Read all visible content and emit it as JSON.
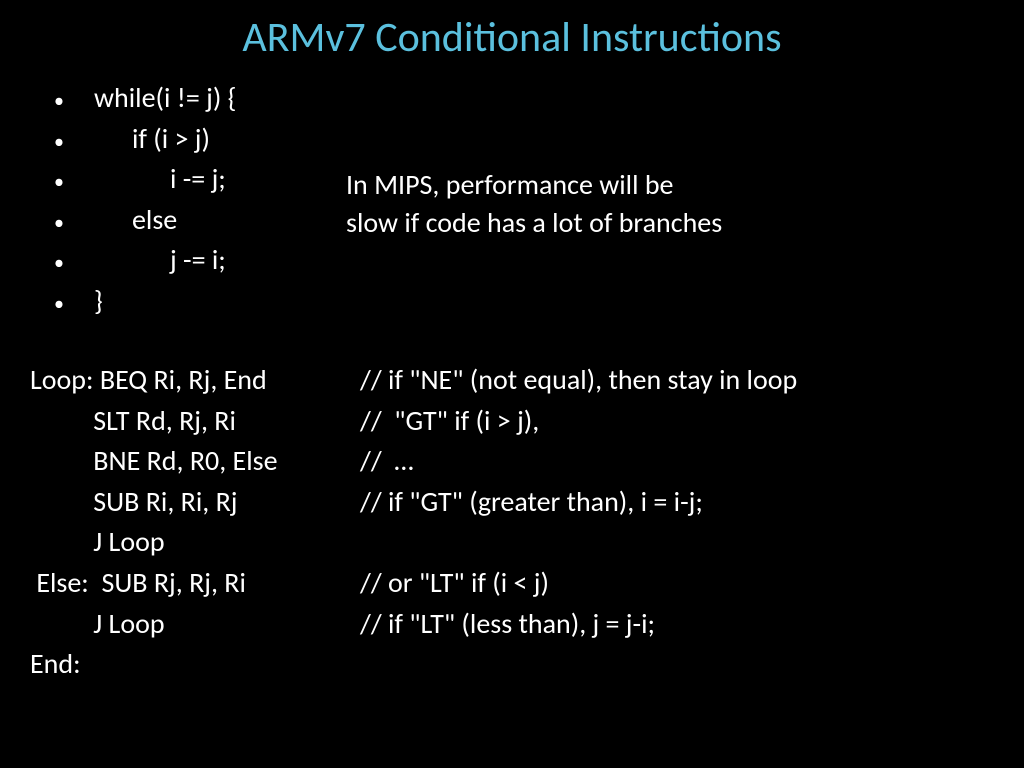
{
  "title": "ARMv7 Conditional Instructions",
  "bullets": [
    "while(i != j) {",
    "      if (i > j)",
    "            i -= j;",
    "      else",
    "            j -= i;",
    "}"
  ],
  "note_line1": "In MIPS, performance will be",
  "note_line2": "slow if code has a lot of branches",
  "asm": [
    {
      "left": "Loop: BEQ Ri, Rj, End",
      "right": "// if \"NE\" (not equal), then stay in loop"
    },
    {
      "left": "          SLT Rd, Rj, Ri",
      "right": "//  \"GT\" if (i > j),"
    },
    {
      "left": "          BNE Rd, R0, Else",
      "right": "//  …"
    },
    {
      "left": "          SUB Ri, Ri, Rj",
      "right": "// if \"GT\" (greater than), i = i-j;"
    },
    {
      "left": "          J Loop",
      "right": ""
    },
    {
      "left": " Else:  SUB Rj, Rj, Ri",
      "right": "// or \"LT\" if (i < j)"
    },
    {
      "left": "          J Loop",
      "right": "// if \"LT\" (less than), j = j-i;"
    },
    {
      "left": "End:",
      "right": ""
    }
  ]
}
